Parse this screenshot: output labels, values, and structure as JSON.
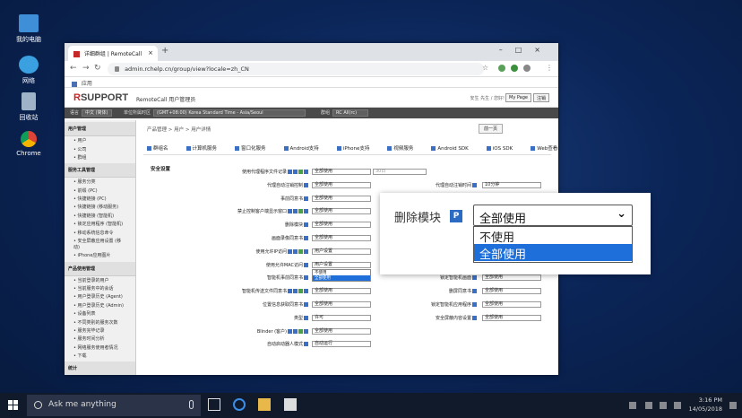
{
  "desktop": {
    "icons": [
      {
        "label": "我的电脑",
        "color": "#3f8fd8"
      },
      {
        "label": "网络",
        "color": "#3aa0e0"
      },
      {
        "label": "回收站",
        "color": "#9fb3c8"
      },
      {
        "label": "Chrome",
        "color": "#e8a02a"
      }
    ]
  },
  "browser": {
    "tab_title": "详细群组 | RemoteCall",
    "url": "admin.rchelp.cn/group/view?locale=zh_CN",
    "bookmark_apps": "应用"
  },
  "app": {
    "logo_r": "R",
    "logo_rest": "SUPPORT",
    "title": "RemoteCall 用户管理员",
    "user_info": "安生 先生 / 您好!",
    "my_page": "My Page",
    "logout": "注销",
    "filter": {
      "lang_label": "语言",
      "lang_value": "中文 (简体)",
      "tz_label": "单位所属时区",
      "tz_value": "(GMT+08:00) Korea Standard Time - Asia/Seoul",
      "group_label": "群组",
      "group_value": "RC All(rc)"
    }
  },
  "sidebar": {
    "sections": [
      {
        "title": "用户管理",
        "items": [
          "用户",
          "公司",
          "群组"
        ]
      },
      {
        "title": "服务工具管理",
        "items": [
          "服务分类",
          "前缀 (PC)",
          "快捷链接 (PC)",
          "快捷链接 (移动服务)",
          "快捷链接 (智能机)",
          "锁定应用程序 (智能机)",
          "移动系统信息命令",
          "安全屏蔽应用设置 (移动)",
          "iPhone应用图片"
        ]
      },
      {
        "title": "产品使用管理",
        "items": [
          "当前登录的用户",
          "当前服务中的会话",
          "用户登录历史 (Agent)",
          "用户登录历史 (Admin)",
          "设备列表",
          "不同类别的服务次数",
          "服务完毕记录",
          "服务时间分析",
          "网络服务使用者情况",
          "下载"
        ]
      },
      {
        "title": "统计",
        "items": []
      }
    ]
  },
  "main": {
    "breadcrumb": "产品管理 > 用户 > 用户详情",
    "prev_button": "前一页",
    "tabs": [
      "群组名",
      "计算机服务",
      "窗口化服务",
      "Android支持",
      "iPhone支持",
      "视频服务",
      "Android SDK",
      "iOS SDK",
      "Web查看器"
    ],
    "section_title": "安全设置",
    "rows": [
      {
        "label": "使用代理程序文件记录",
        "value": "全部使用",
        "extra": "30日"
      },
      {
        "label": "代理自动注销控制",
        "value": "全部使用",
        "label2": "代理自动注销时间",
        "value2": "10分钟"
      },
      {
        "label": "事前同意书",
        "value": "全部使用"
      },
      {
        "label": "禁止控制客户端显示窗口",
        "value": "全部使用"
      },
      {
        "label": "删除模块",
        "value": "全部使用"
      },
      {
        "label": "画面录像同意书",
        "value": "全部使用"
      },
      {
        "label": "使用允许IP访问",
        "value": "用户设置"
      },
      {
        "label": "使用允许MAC访问",
        "value": "用户设置"
      },
      {
        "label": "智能机事前同意书",
        "value": "全部使用",
        "label2": "锁定智能机画面",
        "value2": "全部使用"
      },
      {
        "label": "智能机传送文件同意书",
        "value": "全部使用",
        "label2": "删屏同意书",
        "value2": "全部使用"
      },
      {
        "label": "位置信息获取同意书",
        "value": "全部使用",
        "label2": "锁定智能机应用程序",
        "value2": "全部使用"
      },
      {
        "label": "类型",
        "value": "许可",
        "label2": "安全屏蔽内容设置",
        "value2": "全部使用"
      },
      {
        "label": "Blinder (客户)",
        "value": "全部使用"
      },
      {
        "label": "自动启动器人模式",
        "value": "自动运行"
      }
    ],
    "mini_dropdown": [
      "不使用",
      "全部使用"
    ]
  },
  "zoom_popup": {
    "label": "删除模块",
    "badge": "P",
    "selected": "全部使用",
    "options": [
      "不使用",
      "全部使用"
    ]
  },
  "taskbar": {
    "search_placeholder": "Ask me anything",
    "time": "3:16 PM",
    "date": "14/05/2018"
  }
}
